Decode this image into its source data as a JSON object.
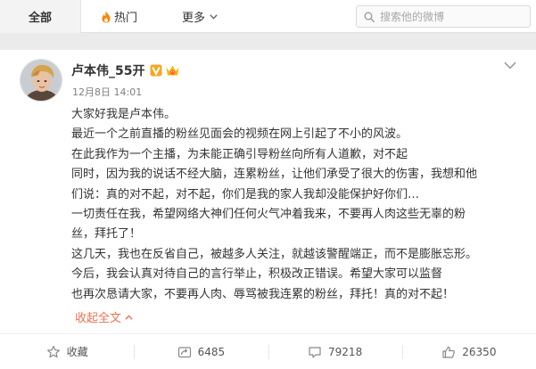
{
  "topbar": {
    "tab_all": "全部",
    "tab_hot": "热门",
    "tab_more": "更多",
    "search_placeholder": "搜索他的微博"
  },
  "post": {
    "author": "卢本伟_55开",
    "time": "12月8日 14:01",
    "lines": [
      "大家好我是卢本伟。",
      "最近一个之前直播的粉丝见面会的视频在网上引起了不小的风波。",
      "在此我作为一个主播，为未能正确引导粉丝向所有人道歉，对不起",
      "同时，因为我的说话不经大脑，连累粉丝，让他们承受了很大的伤害，我想和他",
      "们说：真的对不起，对不起，你们是我的家人我却没能保护好你们…",
      "一切责任在我，希望网络大神们任何火气冲着我来，不要再人肉这些无辜的粉",
      "丝，拜托了！",
      "这几天，我也在反省自己，被越多人关注，就越该警醒端正，而不是膨胀忘形。",
      "今后，我会认真对待自己的言行举止，积极改正错误。希望大家可以监督",
      "也再次恳请大家，不要再人肉、辱骂被我连累的粉丝，拜托！真的对不起！"
    ],
    "collapse_label": "收起全文"
  },
  "actions": {
    "favorite": "收藏",
    "repost_count": "6485",
    "comment_count": "79218",
    "like_count": "26350"
  },
  "colors": {
    "accent_orange": "#eb7350",
    "verified_yellow": "#f5a623"
  }
}
